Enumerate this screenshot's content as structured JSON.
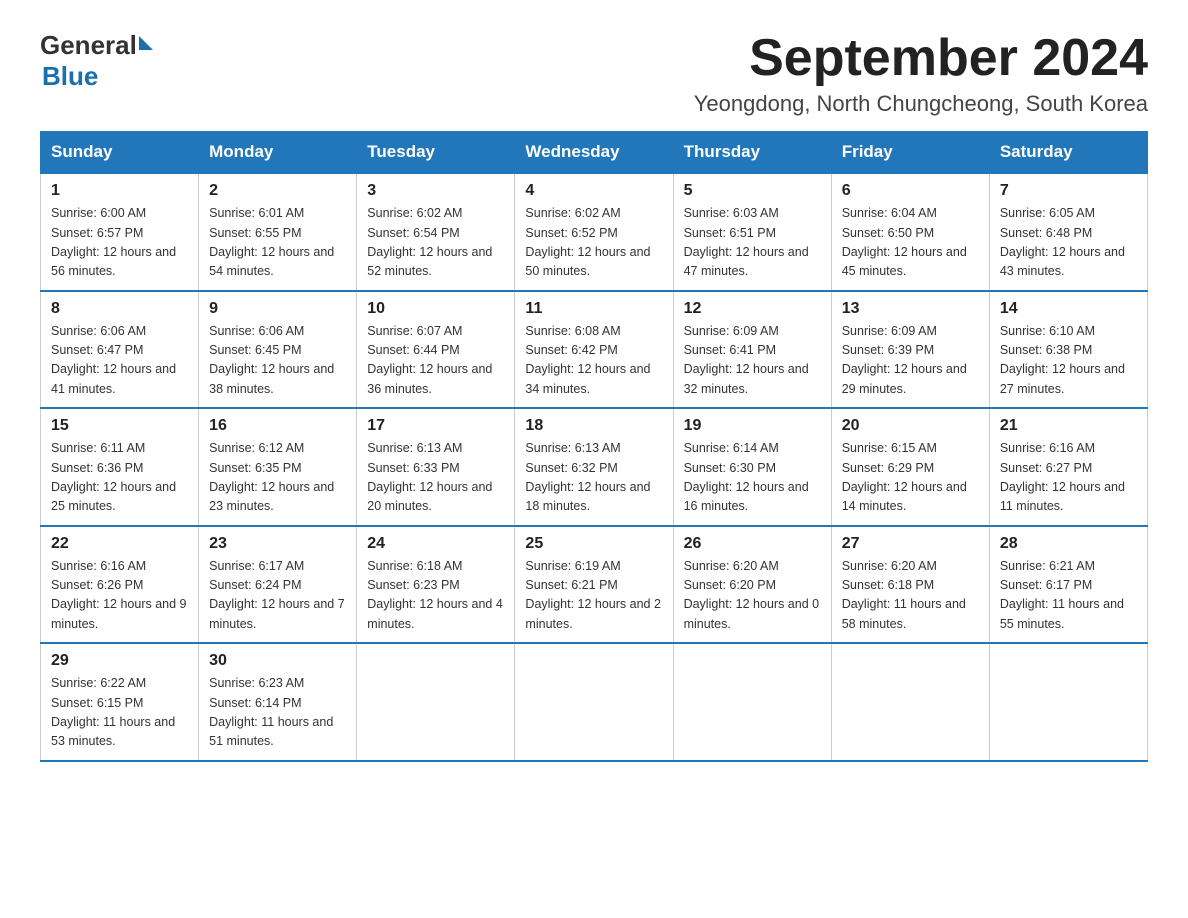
{
  "logo": {
    "general": "General",
    "blue": "Blue"
  },
  "title": "September 2024",
  "location": "Yeongdong, North Chungcheong, South Korea",
  "weekdays": [
    "Sunday",
    "Monday",
    "Tuesday",
    "Wednesday",
    "Thursday",
    "Friday",
    "Saturday"
  ],
  "weeks": [
    [
      {
        "day": "1",
        "sunrise": "6:00 AM",
        "sunset": "6:57 PM",
        "daylight": "12 hours and 56 minutes."
      },
      {
        "day": "2",
        "sunrise": "6:01 AM",
        "sunset": "6:55 PM",
        "daylight": "12 hours and 54 minutes."
      },
      {
        "day": "3",
        "sunrise": "6:02 AM",
        "sunset": "6:54 PM",
        "daylight": "12 hours and 52 minutes."
      },
      {
        "day": "4",
        "sunrise": "6:02 AM",
        "sunset": "6:52 PM",
        "daylight": "12 hours and 50 minutes."
      },
      {
        "day": "5",
        "sunrise": "6:03 AM",
        "sunset": "6:51 PM",
        "daylight": "12 hours and 47 minutes."
      },
      {
        "day": "6",
        "sunrise": "6:04 AM",
        "sunset": "6:50 PM",
        "daylight": "12 hours and 45 minutes."
      },
      {
        "day": "7",
        "sunrise": "6:05 AM",
        "sunset": "6:48 PM",
        "daylight": "12 hours and 43 minutes."
      }
    ],
    [
      {
        "day": "8",
        "sunrise": "6:06 AM",
        "sunset": "6:47 PM",
        "daylight": "12 hours and 41 minutes."
      },
      {
        "day": "9",
        "sunrise": "6:06 AM",
        "sunset": "6:45 PM",
        "daylight": "12 hours and 38 minutes."
      },
      {
        "day": "10",
        "sunrise": "6:07 AM",
        "sunset": "6:44 PM",
        "daylight": "12 hours and 36 minutes."
      },
      {
        "day": "11",
        "sunrise": "6:08 AM",
        "sunset": "6:42 PM",
        "daylight": "12 hours and 34 minutes."
      },
      {
        "day": "12",
        "sunrise": "6:09 AM",
        "sunset": "6:41 PM",
        "daylight": "12 hours and 32 minutes."
      },
      {
        "day": "13",
        "sunrise": "6:09 AM",
        "sunset": "6:39 PM",
        "daylight": "12 hours and 29 minutes."
      },
      {
        "day": "14",
        "sunrise": "6:10 AM",
        "sunset": "6:38 PM",
        "daylight": "12 hours and 27 minutes."
      }
    ],
    [
      {
        "day": "15",
        "sunrise": "6:11 AM",
        "sunset": "6:36 PM",
        "daylight": "12 hours and 25 minutes."
      },
      {
        "day": "16",
        "sunrise": "6:12 AM",
        "sunset": "6:35 PM",
        "daylight": "12 hours and 23 minutes."
      },
      {
        "day": "17",
        "sunrise": "6:13 AM",
        "sunset": "6:33 PM",
        "daylight": "12 hours and 20 minutes."
      },
      {
        "day": "18",
        "sunrise": "6:13 AM",
        "sunset": "6:32 PM",
        "daylight": "12 hours and 18 minutes."
      },
      {
        "day": "19",
        "sunrise": "6:14 AM",
        "sunset": "6:30 PM",
        "daylight": "12 hours and 16 minutes."
      },
      {
        "day": "20",
        "sunrise": "6:15 AM",
        "sunset": "6:29 PM",
        "daylight": "12 hours and 14 minutes."
      },
      {
        "day": "21",
        "sunrise": "6:16 AM",
        "sunset": "6:27 PM",
        "daylight": "12 hours and 11 minutes."
      }
    ],
    [
      {
        "day": "22",
        "sunrise": "6:16 AM",
        "sunset": "6:26 PM",
        "daylight": "12 hours and 9 minutes."
      },
      {
        "day": "23",
        "sunrise": "6:17 AM",
        "sunset": "6:24 PM",
        "daylight": "12 hours and 7 minutes."
      },
      {
        "day": "24",
        "sunrise": "6:18 AM",
        "sunset": "6:23 PM",
        "daylight": "12 hours and 4 minutes."
      },
      {
        "day": "25",
        "sunrise": "6:19 AM",
        "sunset": "6:21 PM",
        "daylight": "12 hours and 2 minutes."
      },
      {
        "day": "26",
        "sunrise": "6:20 AM",
        "sunset": "6:20 PM",
        "daylight": "12 hours and 0 minutes."
      },
      {
        "day": "27",
        "sunrise": "6:20 AM",
        "sunset": "6:18 PM",
        "daylight": "11 hours and 58 minutes."
      },
      {
        "day": "28",
        "sunrise": "6:21 AM",
        "sunset": "6:17 PM",
        "daylight": "11 hours and 55 minutes."
      }
    ],
    [
      {
        "day": "29",
        "sunrise": "6:22 AM",
        "sunset": "6:15 PM",
        "daylight": "11 hours and 53 minutes."
      },
      {
        "day": "30",
        "sunrise": "6:23 AM",
        "sunset": "6:14 PM",
        "daylight": "11 hours and 51 minutes."
      },
      null,
      null,
      null,
      null,
      null
    ]
  ]
}
